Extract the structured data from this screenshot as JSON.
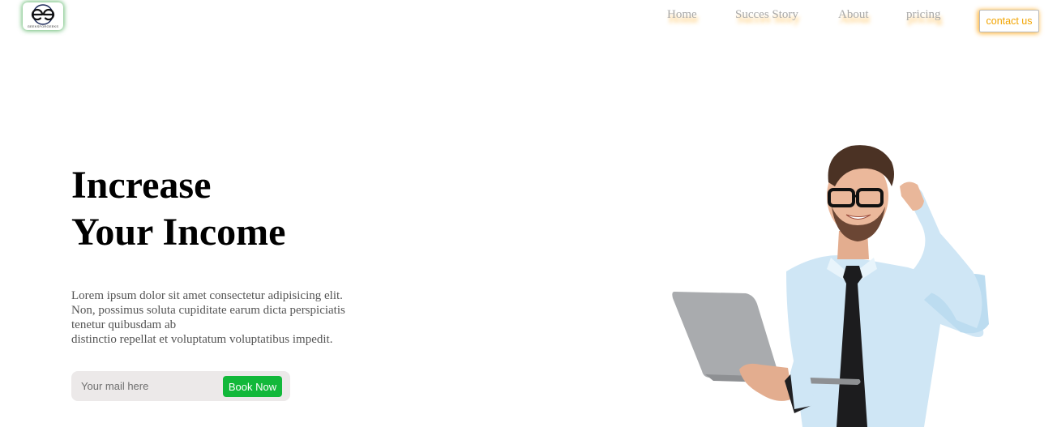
{
  "brand": {
    "logo_text": "GEEKSFORGEEKS"
  },
  "nav": {
    "items": [
      {
        "label": "Home"
      },
      {
        "label": "Succes Story"
      },
      {
        "label": "About"
      },
      {
        "label": "pricing"
      }
    ],
    "contact_label": "contact us"
  },
  "hero": {
    "title_line1": "Increase",
    "title_line2": "Your Income",
    "desc_line1": "Lorem ipsum dolor sit amet consectetur adipisicing elit.",
    "desc_line2": "Non, possimus soluta cupiditate earum dicta perspiciatis",
    "desc_line3": "tenetur quibusdam ab",
    "desc_line4": "distinctio repellat et voluptatum voluptatibus impedit.",
    "email_placeholder": "Your mail here",
    "book_label": "Book Now"
  },
  "colors": {
    "nav_text": "#a9a9a9",
    "nav_glow": "#ffaf28",
    "contact_text": "#f2a400",
    "book_button": "#12b83a",
    "input_bg": "#ece9e9",
    "logo_glow": "#2ea03c"
  },
  "icons": {
    "logo": "gfg-logo-icon",
    "hero": "businessman-with-laptop-illustration"
  }
}
